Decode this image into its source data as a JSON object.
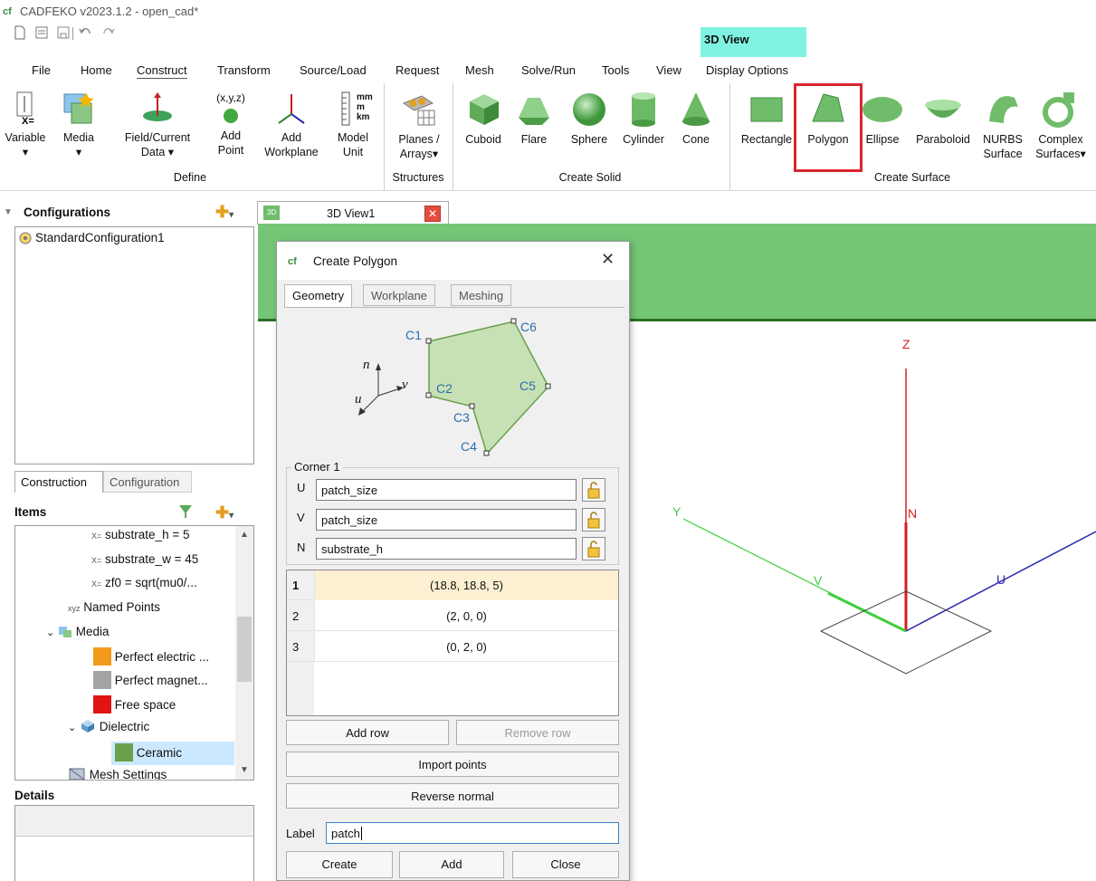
{
  "app": {
    "title": "CADFEKO v2023.1.2 - open_cad*"
  },
  "context_tab": "3D View",
  "menu_tabs": [
    "File",
    "Home",
    "Construct",
    "Transform",
    "Source/Load",
    "Request",
    "Mesh",
    "Solve/Run",
    "Tools",
    "View",
    "Display Options"
  ],
  "ribbon": {
    "define": {
      "label": "Define",
      "variable": "Variable",
      "media": "Media",
      "field_current": "Field/Current\nData",
      "add_point": "Add\nPoint",
      "add_point_icon_text": "(x,y,z)",
      "add_workplane": "Add\nWorkplane",
      "model_unit": "Model\nUnit",
      "unit_icon_text": "mm\nm\nkm",
      "variable_icon_text": "X="
    },
    "structures": {
      "label": "Structures",
      "planes_arrays": "Planes /\nArrays"
    },
    "create_solid": {
      "label": "Create Solid",
      "cuboid": "Cuboid",
      "flare": "Flare",
      "sphere": "Sphere",
      "cylinder": "Cylinder",
      "cone": "Cone"
    },
    "create_surface": {
      "label": "Create Surface",
      "rectangle": "Rectangle",
      "polygon": "Polygon",
      "ellipse": "Ellipse",
      "paraboloid": "Paraboloid",
      "nurbs": "NURBS\nSurface",
      "complex": "Complex\nSurfaces"
    }
  },
  "configurations": {
    "header": "Configurations",
    "item": "StandardConfiguration1"
  },
  "view_tab": {
    "label": "3D View1",
    "icon_text": "3D"
  },
  "bottom_tabs": [
    "Construction",
    "Configuration"
  ],
  "items": {
    "header": "Items",
    "vars": [
      "substrate_h = 5",
      "substrate_w = 45",
      "zf0 = sqrt(mu0/..."
    ],
    "var_icon_text": "X=",
    "named_points": "Named Points",
    "named_points_icon_text": "xyz",
    "media": "Media",
    "media_items": [
      {
        "label": "Perfect electric ...",
        "color": "#f39a1c"
      },
      {
        "label": "Perfect magnet...",
        "color": "#a4a4a4"
      },
      {
        "label": "Free space",
        "color": "#e01414"
      }
    ],
    "dielectric": "Dielectric",
    "ceramic": {
      "label": "Ceramic",
      "color": "#6aa04a"
    },
    "mesh_settings": "Mesh Settings"
  },
  "details": {
    "header": "Details"
  },
  "dialog": {
    "title": "Create Polygon",
    "tabs": [
      "Geometry",
      "Workplane",
      "Meshing"
    ],
    "diagram": {
      "c1": "C1",
      "c2": "C2",
      "c3": "C3",
      "c4": "C4",
      "c5": "C5",
      "c6": "C6",
      "n": "n",
      "u": "u",
      "v": "v"
    },
    "corner_group": "Corner 1",
    "u_label": "U",
    "v_label": "V",
    "n_label": "N",
    "u_value": "patch_size",
    "v_value": "patch_size",
    "n_value": "substrate_h",
    "rows": [
      {
        "n": "1",
        "v": "(18.8, 18.8, 5)"
      },
      {
        "n": "2",
        "v": "(2, 0, 0)"
      },
      {
        "n": "3",
        "v": "(0, 2, 0)"
      }
    ],
    "add_row": "Add row",
    "remove_row": "Remove row",
    "import_points": "Import points",
    "reverse_normal": "Reverse normal",
    "label_caption": "Label",
    "label_value": "patch",
    "create": "Create",
    "add": "Add",
    "close": "Close"
  },
  "axes": {
    "z": "Z",
    "y": "Y",
    "n": "N",
    "v": "V",
    "u": "U"
  },
  "colors": {
    "accent_green": "#74c576",
    "highlight_red": "#d9262e",
    "context_tab": "#7ff3e1",
    "axis_red": "#d31f1f",
    "axis_green": "#3fcf3f",
    "axis_blue": "#2b2bb0"
  }
}
